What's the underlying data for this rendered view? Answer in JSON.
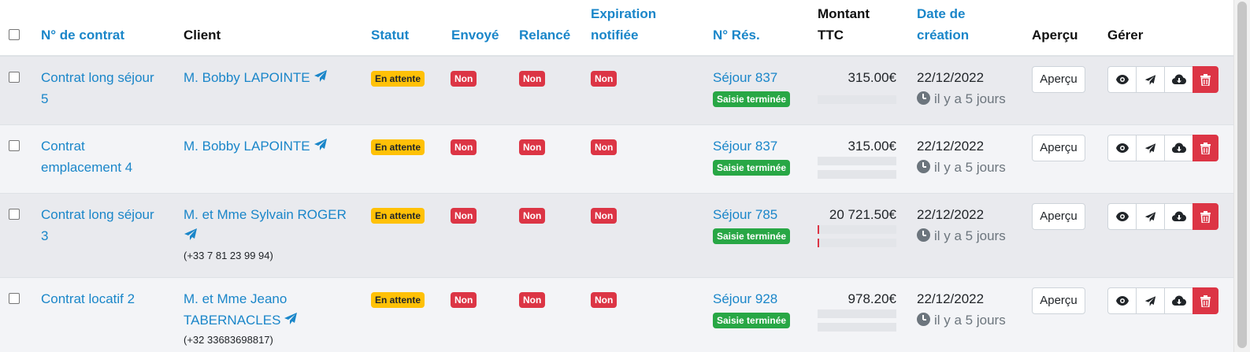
{
  "header": {
    "contract_no": "N° de contrat",
    "client": "Client",
    "statut": "Statut",
    "envoye": "Envoyé",
    "relance": "Relancé",
    "expiration_l1": "Expiration",
    "expiration_l2": "notifiée",
    "num_res": "N° Rés.",
    "montant_l1": "Montant",
    "montant_l2": "TTC",
    "date_l1": "Date de",
    "date_l2": "création",
    "apercu": "Aperçu",
    "gerer": "Gérer"
  },
  "rows": [
    {
      "contract_l1": "Contrat long séjour",
      "contract_l2": "5",
      "client_l1": "M. Bobby LAPOINTE",
      "client_l2": "",
      "phone": "",
      "statut": "En attente",
      "envoye": "Non",
      "relance": "Non",
      "expiration": "Non",
      "sejour": "Séjour 837",
      "saisie": "Saisie terminée",
      "montant": "315.00€",
      "date": "22/12/2022",
      "relative": "il y a 5 jours",
      "apercu_btn": "Aperçu"
    },
    {
      "contract_l1": "Contrat",
      "contract_l2": "emplacement 4",
      "client_l1": "M. Bobby LAPOINTE",
      "client_l2": "",
      "phone": "",
      "statut": "En attente",
      "envoye": "Non",
      "relance": "Non",
      "expiration": "Non",
      "sejour": "Séjour 837",
      "saisie": "Saisie terminée",
      "montant": "315.00€",
      "date": "22/12/2022",
      "relative": "il y a 5 jours",
      "apercu_btn": "Aperçu"
    },
    {
      "contract_l1": "Contrat long séjour",
      "contract_l2": "3",
      "client_l1": "M. et Mme Sylvain ROGER",
      "client_l2": "",
      "phone": "(+33 7 81 23 99 94)",
      "statut": "En attente",
      "envoye": "Non",
      "relance": "Non",
      "expiration": "Non",
      "sejour": "Séjour 785",
      "saisie": "Saisie terminée",
      "montant": "20 721.50€",
      "date": "22/12/2022",
      "relative": "il y a 5 jours",
      "apercu_btn": "Aperçu"
    },
    {
      "contract_l1": "Contrat locatif 2",
      "contract_l2": "",
      "client_l1": "M. et Mme Jeano",
      "client_l2": "TABERNACLES",
      "phone": "(+32 33683698817)",
      "statut": "En attente",
      "envoye": "Non",
      "relance": "Non",
      "expiration": "Non",
      "sejour": "Séjour 928",
      "saisie": "Saisie terminée",
      "montant": "978.20€",
      "date": "22/12/2022",
      "relative": "il y a 5 jours",
      "apercu_btn": "Aperçu"
    }
  ],
  "colors": {
    "link": "#1a86c9",
    "warning": "#ffc107",
    "danger": "#dc3545",
    "success": "#28a745",
    "row_odd": "#e9eaee",
    "row_even": "#f3f4f7"
  },
  "icons": {
    "send": "paper-plane-icon",
    "view": "eye-icon",
    "download": "cloud-download-icon",
    "delete": "trash-icon",
    "time": "clock-icon"
  }
}
